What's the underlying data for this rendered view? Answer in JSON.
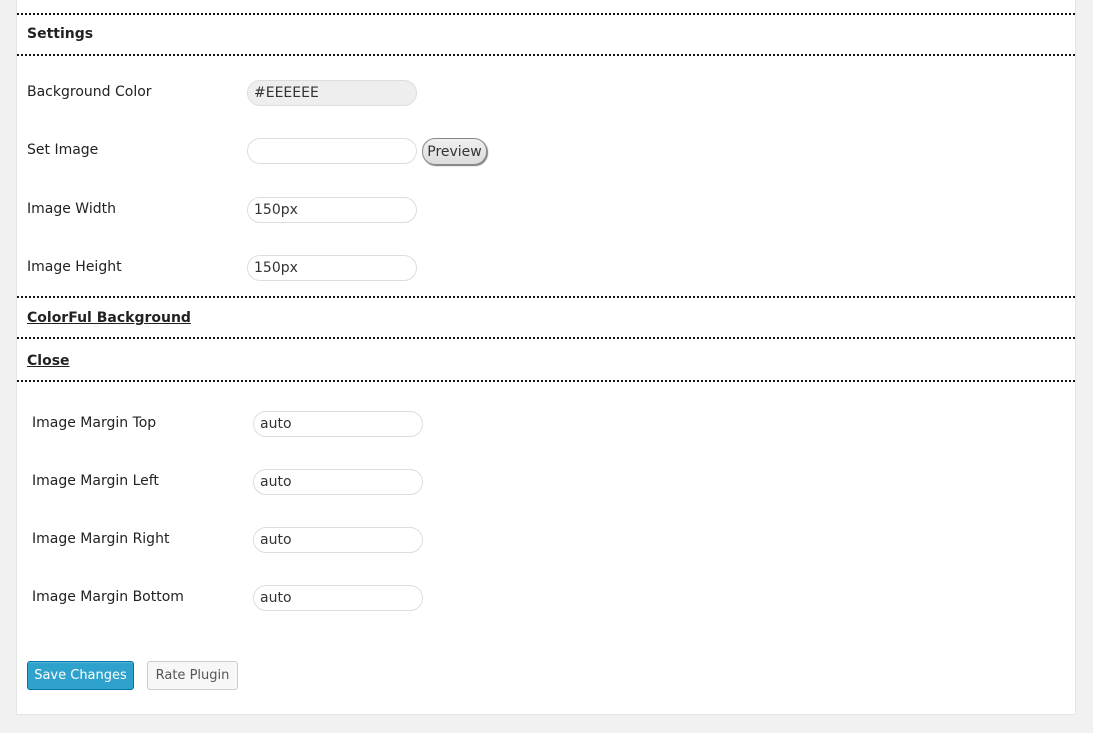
{
  "settings_header": {
    "title": "Settings"
  },
  "fields": {
    "background_color": {
      "label": "Background Color",
      "value": "#EEEEEE"
    },
    "set_image": {
      "label": "Set Image",
      "value": "",
      "button_label": "Preview"
    },
    "image_width": {
      "label": "Image Width",
      "value": "150px"
    },
    "image_height": {
      "label": "Image Height",
      "value": "150px"
    }
  },
  "sections": {
    "colorful_background": "ColorFul Background",
    "close": "Close"
  },
  "margins": {
    "top": {
      "label": "Image Margin Top",
      "value": "auto"
    },
    "left": {
      "label": "Image Margin Left",
      "value": "auto"
    },
    "right": {
      "label": "Image Margin Right",
      "value": "auto"
    },
    "bottom": {
      "label": "Image Margin Bottom",
      "value": "auto"
    }
  },
  "actions": {
    "save_label": "Save Changes",
    "rate_label": "Rate Plugin"
  },
  "colors": {
    "primary_button": "#2ea2cc",
    "page_background": "#f1f1f1",
    "color_field_background": "#eeeeee"
  }
}
